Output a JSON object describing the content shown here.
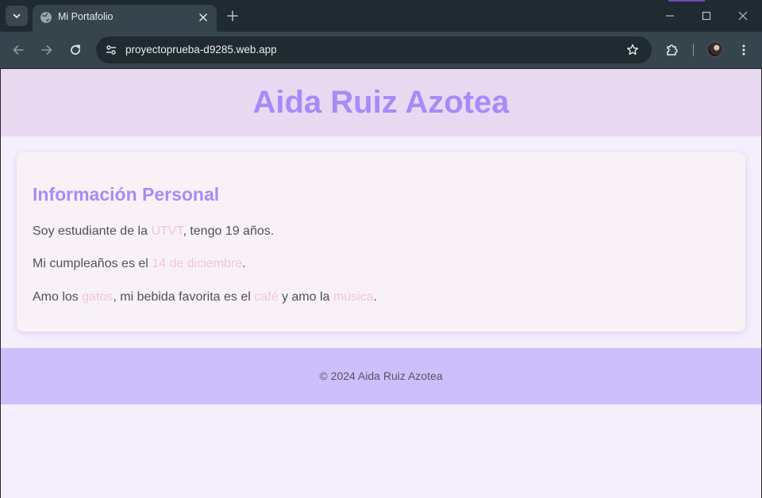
{
  "browser": {
    "tab_title": "Mi Portafolio",
    "url": "proyectoprueba-d9285.web.app"
  },
  "page": {
    "header_title": "Aida Ruiz Azotea",
    "section_title": "Información Personal",
    "p1": {
      "a": "Soy estudiante de la ",
      "b": "UTVT",
      "c": ", tengo 19 años."
    },
    "p2": {
      "a": "Mi cumpleaños es el ",
      "b": "14 de diciembre",
      "c": "."
    },
    "p3": {
      "a": "Amo los ",
      "b": "gatos",
      "c": ", mi bebida favorita es el ",
      "d": "café",
      "e": " y amo la ",
      "f": "música",
      "g": "."
    },
    "footer": "© 2024 Aida Ruiz Azotea"
  },
  "colors": {
    "accent_purple": "#a78bfa",
    "highlight_pink": "#f6c3d9",
    "header_bg": "#e8d9f0",
    "footer_bg": "#cbbffc"
  }
}
